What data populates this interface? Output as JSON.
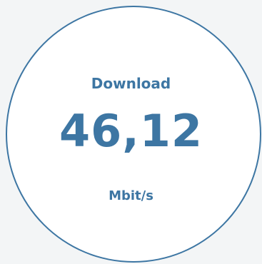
{
  "speedtest": {
    "label": "Download",
    "value": "46,12",
    "unit": "Mbit/s"
  }
}
